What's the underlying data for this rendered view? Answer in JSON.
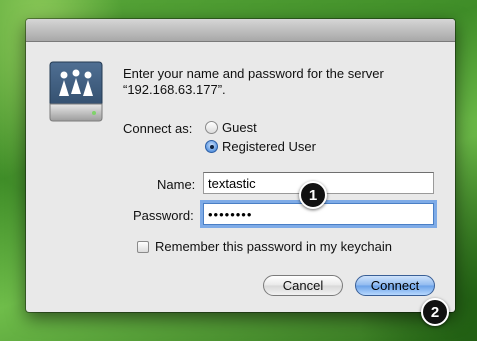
{
  "dialog": {
    "message": "Enter your name and password for the server “192.168.63.177”.",
    "connect_as_label": "Connect as:",
    "radio_guest": "Guest",
    "radio_registered": "Registered User",
    "selected_role": "Registered User",
    "name_label": "Name:",
    "name_value": "textastic",
    "password_label": "Password:",
    "password_value": "••••••••",
    "remember_label": "Remember this password in my keychain",
    "remember_checked": false,
    "cancel_label": "Cancel",
    "connect_label": "Connect"
  },
  "annotations": {
    "step1": "1",
    "step2": "2"
  },
  "icons": {
    "server": "file-server-icon"
  },
  "colors": {
    "accent": "#5d97e0",
    "background": "#4a9a30"
  }
}
